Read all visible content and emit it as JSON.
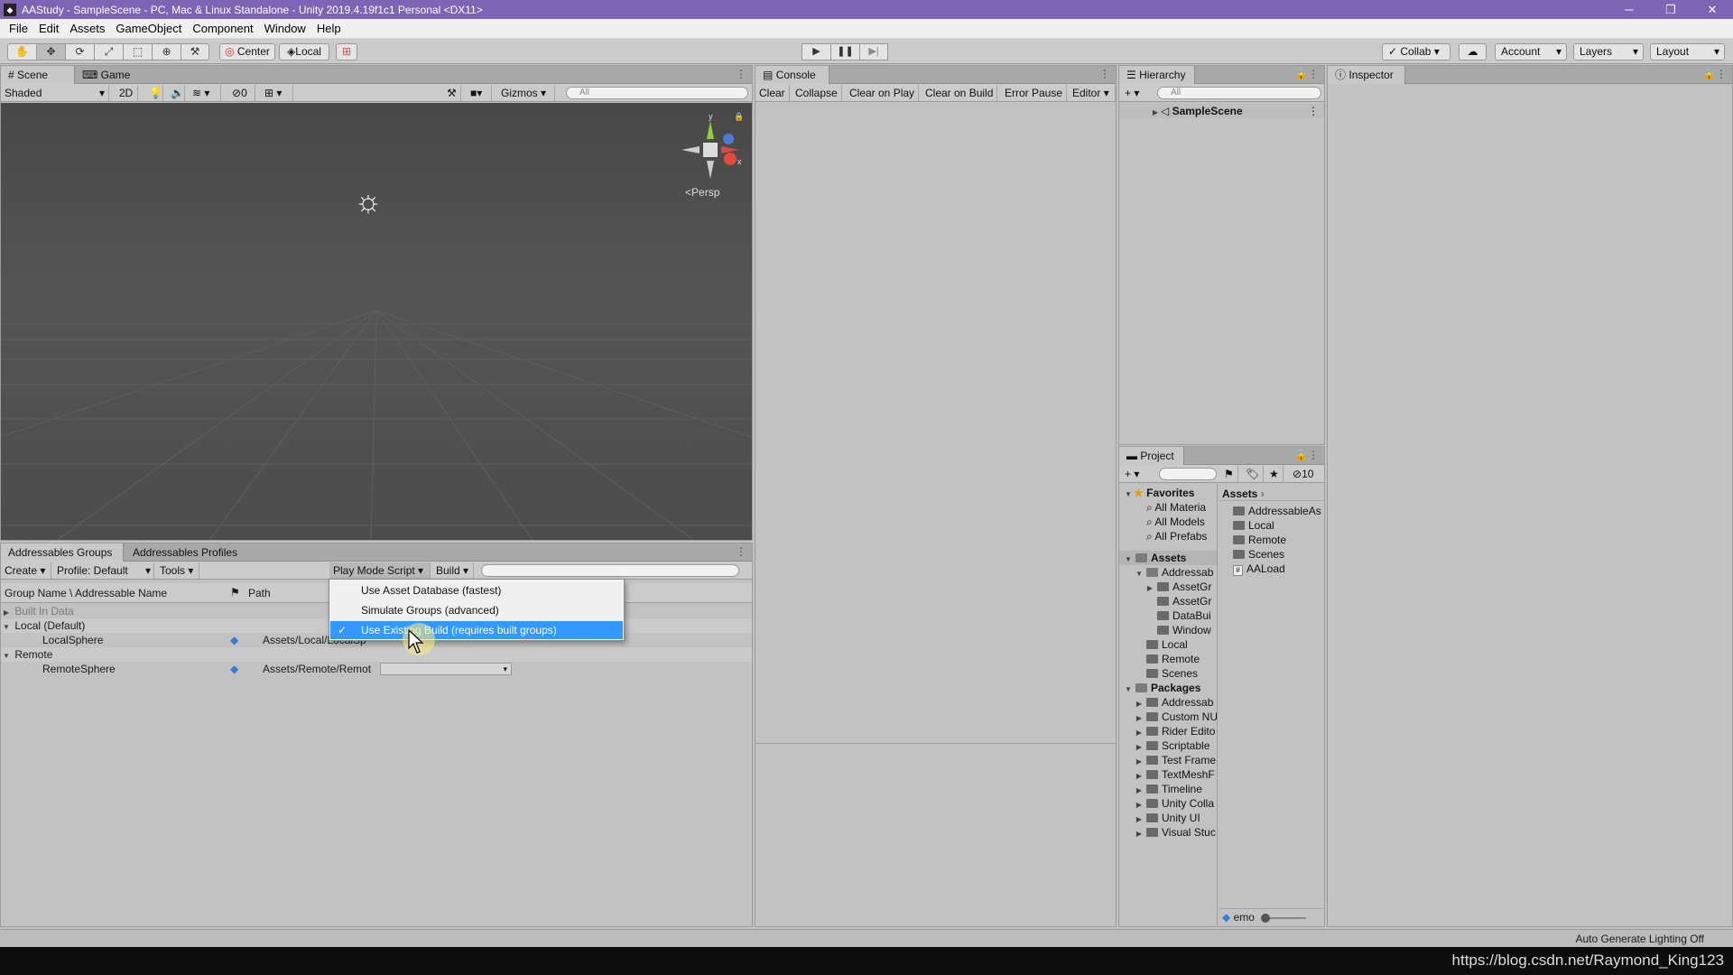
{
  "window": {
    "title": "AAStudy - SampleScene - PC, Mac & Linux Standalone - Unity 2019.4.19f1c1 Personal <DX11>",
    "controls": [
      "─",
      "❐",
      "✕"
    ]
  },
  "menu": [
    "File",
    "Edit",
    "Assets",
    "GameObject",
    "Component",
    "Window",
    "Help"
  ],
  "toolbar": {
    "tools": [
      "✋",
      "✥",
      "⟳",
      "⤢",
      "⬚",
      "⊕",
      "⚒"
    ],
    "pivot_label": "Center",
    "space_label": "Local",
    "collab_label": "Collab",
    "account_label": "Account",
    "layers_label": "Layers",
    "layout_label": "Layout"
  },
  "scene": {
    "tabs": [
      "Scene",
      "Game"
    ],
    "shading": "Shaded",
    "mode_2d": "2D",
    "hidden_count": "0",
    "gizmos_label": "Gizmos",
    "search_placeholder": "All",
    "persp_label": "Persp",
    "axis_y": "y",
    "axis_x": "x"
  },
  "console": {
    "tab": "Console",
    "buttons": [
      "Clear",
      "Collapse",
      "Clear on Play",
      "Clear on Build",
      "Error Pause",
      "Editor"
    ]
  },
  "hierarchy": {
    "tab": "Hierarchy",
    "search_placeholder": "All",
    "root": "SampleScene"
  },
  "inspector": {
    "tab": "Inspector"
  },
  "project": {
    "tab": "Project",
    "hidden_count": "10",
    "favorites_label": "Favorites",
    "favorites": [
      "All Materia",
      "All Models",
      "All Prefabs"
    ],
    "assets_label": "Assets",
    "assets_tree": [
      "Addressab",
      "AssetGr",
      "AssetGr",
      "DataBui",
      "Window",
      "Local",
      "Remote",
      "Scenes"
    ],
    "packages_label": "Packages",
    "packages": [
      "Addressab",
      "Custom NU",
      "Rider Edito",
      "Scriptable",
      "Test Frame",
      "TextMeshF",
      "Timeline",
      "Unity Colla",
      "Unity UI",
      "Visual Stuc"
    ],
    "breadcrumb": "Assets",
    "right_items": [
      "AddressableAs",
      "Local",
      "Remote",
      "Scenes",
      "AALoad"
    ],
    "footer_label": "emo"
  },
  "addressables": {
    "tabs": [
      "Addressables Groups",
      "Addressables Profiles"
    ],
    "create_label": "Create",
    "profile_label": "Profile: Default",
    "tools_label": "Tools",
    "playmode_label": "Play Mode Script",
    "build_label": "Build",
    "col_name": "Group Name \\ Addressable Name",
    "col_path": "Path",
    "rows": [
      {
        "name": "Built In Data",
        "path": ""
      },
      {
        "name": "Local (Default)",
        "path": ""
      },
      {
        "name": "LocalSphere",
        "path": "Assets/Local/LocalSp"
      },
      {
        "name": "Remote",
        "path": ""
      },
      {
        "name": "RemoteSphere",
        "path": "Assets/Remote/Remot"
      }
    ]
  },
  "playmode_menu": {
    "items": [
      "Use Asset Database (fastest)",
      "Simulate Groups (advanced)",
      "Use Existing Build (requires built groups)"
    ],
    "selected_index": 2
  },
  "status": {
    "right_text": "Auto Generate Lighting Off"
  },
  "watermark": "https://blog.csdn.net/Raymond_King123"
}
